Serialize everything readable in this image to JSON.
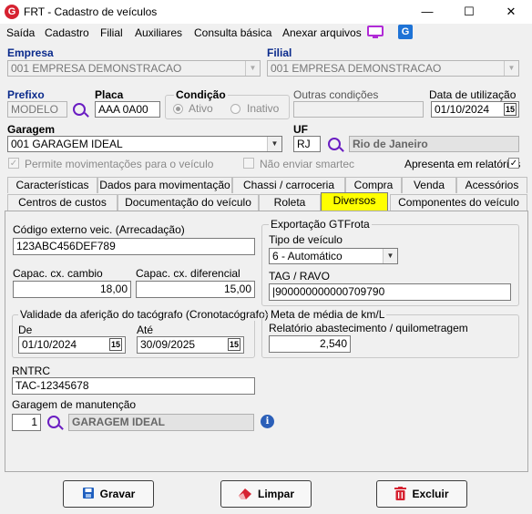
{
  "window": {
    "title": "FRT - Cadastro de veículos",
    "minimize": "—",
    "maximize": "☐",
    "close": "✕"
  },
  "menu": [
    "Saída",
    "Cadastro",
    "Filial",
    "Auxiliares",
    "Consulta básica",
    "Anexar arquivos"
  ],
  "empresa": {
    "label": "Empresa",
    "value": "001 EMPRESA DEMONSTRACAO"
  },
  "filial": {
    "label": "Filial",
    "value": "001 EMPRESA DEMONSTRACAO"
  },
  "prefixo": {
    "label": "Prefixo",
    "value": "MODELO"
  },
  "placa": {
    "label": "Placa",
    "value": "AAA 0A00"
  },
  "condicao": {
    "label": "Condição",
    "ativo": "Ativo",
    "inativo": "Inativo",
    "selected": "Ativo"
  },
  "outras_condicoes": {
    "label": "Outras condições",
    "value": ""
  },
  "data_utilizacao": {
    "label": "Data de utilização",
    "value": "01/10/2024"
  },
  "garagem": {
    "label": "Garagem",
    "value": "001 GARAGEM IDEAL"
  },
  "uf": {
    "label": "UF",
    "value": "RJ",
    "name": "Rio de Janeiro"
  },
  "options": {
    "permite_mov": "Permite movimentações para o veículo",
    "nao_enviar": "Não enviar smartec",
    "apresenta": "Apresenta em relatórios",
    "apresenta_checked": true
  },
  "tabs_row1": [
    "Características",
    "Dados para movimentação",
    "Chassi / carroceria",
    "Compra",
    "Venda",
    "Acessórios"
  ],
  "tabs_row2": [
    "Centros de custos",
    "Documentação do veículo",
    "Roleta",
    "Diversos",
    "Componentes do veículo"
  ],
  "active_tab": "Diversos",
  "diversos": {
    "codigo_externo": {
      "label": "Código externo veic. (Arrecadação)",
      "value": "123ABC456DEF789"
    },
    "capac_cambio": {
      "label": "Capac. cx. cambio",
      "value": "18,00"
    },
    "capac_diferencial": {
      "label": "Capac. cx. diferencial",
      "value": "15,00"
    },
    "tacografo": {
      "title": "Validade da aferição do tacógrafo (Cronotacógrafo)",
      "de_label": "De",
      "de_value": "01/10/2024",
      "ate_label": "Até",
      "ate_value": "30/09/2025"
    },
    "gtfrota": {
      "title": "Exportação GTFrota",
      "tipo_label": "Tipo de veículo",
      "tipo_value": "6 - Automático",
      "tag_label": "TAG / RAVO",
      "tag_value": "|900000000000709790"
    },
    "meta": {
      "title": "Meta de média de km/L",
      "label": "Relatório abastecimento / quilometragem",
      "value": "2,540"
    },
    "rntrc": {
      "label": "RNTRC",
      "value": "TAC-12345678"
    },
    "garagem_manut": {
      "label": "Garagem de manutenção",
      "code": "1",
      "name": "GARAGEM IDEAL"
    }
  },
  "buttons": {
    "gravar": "Gravar",
    "limpar": "Limpar",
    "excluir": "Excluir"
  },
  "calendar_icon_text": "15",
  "colors": {
    "active_tab": "#ffff00",
    "label_blue": "#0a2a8c",
    "search_icon": "#6a1dc2",
    "app_icon": "#d62231"
  }
}
